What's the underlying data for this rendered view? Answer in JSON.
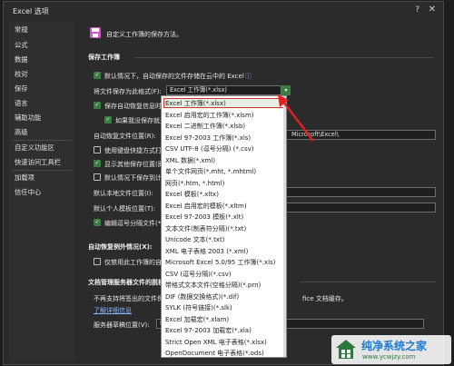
{
  "window": {
    "title": "Excel 选项",
    "help": "?",
    "close": "✕"
  },
  "sidebar": {
    "items": [
      "常规",
      "公式",
      "数据",
      "校对",
      "保存",
      "语言",
      "辅助功能",
      "高级",
      "自定义功能区",
      "快速访问工具栏",
      "加载项",
      "信任中心"
    ],
    "selected": "保存"
  },
  "main": {
    "header": "自定义工作簿的保存方法。",
    "save_section": "保存工作簿",
    "default_cloud": "默认情况下，自动保存的文件存储在云中的 Excel",
    "info_icon": "ⓘ",
    "format_label": "将文件保存为此格式(F):",
    "format_value": "Excel 工作簿(*.xlsx)",
    "autorecover": "保存自动恢复信息时间",
    "keep_last": "如果我没保存就关闭",
    "autorecover_location_label": "自动恢复文件位置(R):",
    "autorecover_path": "Microsoft\\Excel\\",
    "keyboard_shortcuts": "使用键盘快捷方式打开",
    "show_more_places": "显示其他保存位置(即",
    "save_to_computer": "默认情况下保存到计算",
    "local_file_location": "默认本地文件位置(I):",
    "personal_template": "默认个人模板位置(T):",
    "edit_csv": "编辑逗号分隔文件(*.c",
    "autorecover_exceptions": "自动恢复例外情况(X):",
    "disable_autorecover": "仅禁用此工作簿的自",
    "offline_section": "文档管理服务器文件的脱机编",
    "offline_desc": "不再支持将签出的文件保存到",
    "offline_desc2": "fice 文档缓存。",
    "learn_more": "了解详细信息",
    "server_draft_label": "服务器草稿位置(V):",
    "server_draft_value": "D:"
  },
  "dropdown": {
    "options": [
      "Excel 工作簿(*.xlsx)",
      "Excel 启用宏的工作簿(*.xlsm)",
      "Excel 二进制工作簿(*.xlsb)",
      "Excel 97-2003 工作簿(*.xls)",
      "CSV UTF-8 (逗号分隔) (*.csv)",
      "XML 数据(*.xml)",
      "单个文件网页(*.mht, *.mhtml)",
      "网页(*.htm, *.html)",
      "Excel 模板(*.xltx)",
      "Excel 启用宏的模板(*.xltm)",
      "Excel 97-2003 模板(*.xlt)",
      "文本文件(制表符分隔)(*.txt)",
      "Unicode 文本(*.txt)",
      "XML 电子表格 2003 (*.xml)",
      "Microsoft Excel 5.0/95 工作簿(*.xls)",
      "CSV (逗号分隔)(*.csv)",
      "带格式文本文件(空格分隔)(*.prn)",
      "DIF (数据交换格式)(*.dif)",
      "SYLK (符号链接)(*.slk)",
      "Excel 加载宏(*.xlam)",
      "Excel 97-2003 加载宏(*.xla)",
      "Strict Open XML 电子表格(*.xlsx)",
      "OpenDocument 电子表格(*.ods)"
    ],
    "selected_index": 0
  },
  "watermark": {
    "brand": "纯净系统之家",
    "url": "www.ycwjzy.com"
  },
  "colors": {
    "accent": "#3a7d44",
    "highlight_border": "#d43030",
    "arrow": "#e02020"
  }
}
